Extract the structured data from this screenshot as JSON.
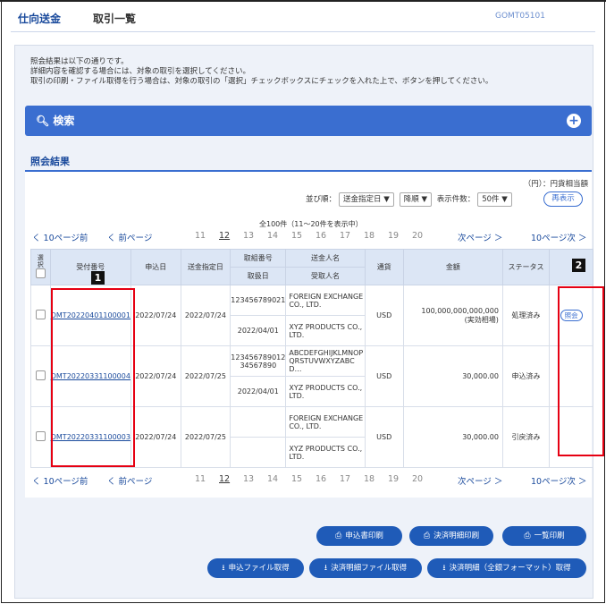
{
  "header": {
    "title": "仕向送金",
    "subtitle": "取引一覧",
    "screen_code": "GOMT05101"
  },
  "intro": {
    "line1": "照会結果は以下の通りです。",
    "line2": "詳細内容を確認する場合には、対象の取引を選択してください。",
    "line3": "取引の印刷・ファイル取得を行う場合は、対象の取引の「選択」チェックボックスにチェックを入れた上で、ボタンを押してください。"
  },
  "search": {
    "label": "検索"
  },
  "results": {
    "title": "照会結果",
    "unit": "（円）：円貨相当額",
    "sort_label": "並び順：",
    "sort_field": "送金指定日 ▼",
    "sort_order": "降順 ▼",
    "count_label": "表示件数：",
    "count_value": "50件 ▼",
    "redisplay": "再表示",
    "total": "全100件（11〜20件を表示中）"
  },
  "pager": {
    "prev10": "く 10ページ前",
    "prev": "く 前ページ",
    "pages": [
      "11",
      "12",
      "13",
      "14",
      "15",
      "16",
      "17",
      "18",
      "19",
      "20"
    ],
    "current": "12",
    "next": "次ページ ＞",
    "next10": "10ページ次 ＞"
  },
  "table": {
    "headers": {
      "select": "選択",
      "receipt_no": "受付番号",
      "apply_date": "申込日",
      "send_date": "送金指定日",
      "trade_no": "取組番号",
      "trade_date": "取扱日",
      "sender": "送金人名",
      "receiver": "受取人名",
      "currency": "通貨",
      "amount": "金額",
      "status": "ステータス"
    },
    "rows": [
      {
        "receipt_no": "OMT20220401100001",
        "apply_date": "2022/07/24",
        "send_date": "2022/07/24",
        "trade_no": "123456789021",
        "trade_date": "2022/04/01",
        "sender": "FOREIGN EXCHANGE CO., LTD.",
        "receiver": "XYZ PRODUCTS CO., LTD.",
        "currency": "USD",
        "amount": "100,000,000,000,000",
        "amount_note": "(実効相場)",
        "status": "処理済み",
        "action": "照会"
      },
      {
        "receipt_no": "OMT20220331100004",
        "apply_date": "2022/07/24",
        "send_date": "2022/07/25",
        "trade_no": "12345678901234567890",
        "trade_date": "2022/04/01",
        "sender": "ABCDEFGHIJKLMNOPQRSTUVWXYZABCD…",
        "receiver": "XYZ PRODUCTS CO., LTD.",
        "currency": "USD",
        "amount": "30,000.00",
        "amount_note": "",
        "status": "申込済み",
        "action": ""
      },
      {
        "receipt_no": "OMT20220331100003",
        "apply_date": "2022/07/24",
        "send_date": "2022/07/25",
        "trade_no": "",
        "trade_date": "",
        "sender": "FOREIGN EXCHANGE CO., LTD.",
        "receiver": "XYZ PRODUCTS CO., LTD.",
        "currency": "USD",
        "amount": "30,000.00",
        "amount_note": "",
        "status": "引戻済み",
        "action": ""
      }
    ]
  },
  "annotations": {
    "badge1": "1",
    "badge2": "2"
  },
  "actions": {
    "print_application": "申込書印刷",
    "print_settlement": "決済明細印刷",
    "print_list": "一覧印刷",
    "file_application": "申込ファイル取得",
    "file_settlement": "決済明細ファイル取得",
    "file_settlement_all": "決済明細（全銀フォーマット）取得"
  },
  "colors": {
    "accent": "#3a6ed0",
    "dark_button": "#1f5bb8",
    "highlight": "#e60012"
  }
}
